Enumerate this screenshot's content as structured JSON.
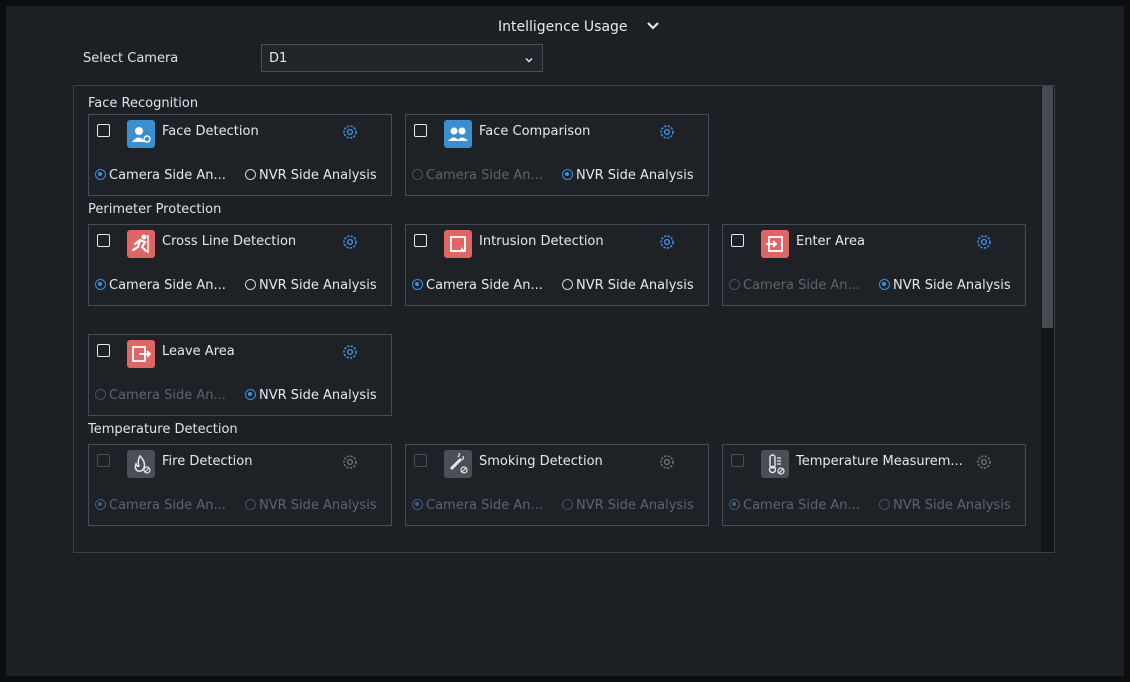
{
  "header": {
    "title": "Intelligence Usage"
  },
  "camera_select": {
    "label": "Select Camera",
    "value": "D1"
  },
  "sections": [
    {
      "title": "Face Recognition"
    },
    {
      "title": "Perimeter Protection"
    },
    {
      "title": "Temperature Detection"
    }
  ],
  "cards": [
    {
      "name": "Face Detection",
      "opt1": "Camera Side An...",
      "opt2": "NVR Side Analysis",
      "selected": "camera",
      "icon": "face-detection-icon"
    },
    {
      "name": "Face Comparison",
      "opt1": "Camera Side An...",
      "opt2": "NVR Side Analysis",
      "selected": "nvr",
      "icon": "face-comparison-icon"
    },
    {
      "name": "Cross Line Detection",
      "opt1": "Camera Side An...",
      "opt2": "NVR Side Analysis",
      "selected": "camera",
      "icon": "cross-line-icon"
    },
    {
      "name": "Intrusion Detection",
      "opt1": "Camera Side An...",
      "opt2": "NVR Side Analysis",
      "selected": "camera",
      "icon": "intrusion-icon"
    },
    {
      "name": "Enter Area",
      "opt1": "Camera Side An...",
      "opt2": "NVR Side Analysis",
      "selected": "nvr",
      "icon": "enter-area-icon"
    },
    {
      "name": "Leave Area",
      "opt1": "Camera Side An...",
      "opt2": "NVR Side Analysis",
      "selected": "nvr",
      "icon": "leave-area-icon"
    },
    {
      "name": "Fire Detection",
      "opt1": "Camera Side An...",
      "opt2": "NVR Side Analysis",
      "selected": "camera",
      "icon": "fire-detection-icon"
    },
    {
      "name": "Smoking Detection",
      "opt1": "Camera Side An...",
      "opt2": "NVR Side Analysis",
      "selected": "camera",
      "icon": "smoking-detection-icon"
    },
    {
      "name": "Temperature Measurem...",
      "opt1": "Camera Side An...",
      "opt2": "NVR Side Analysis",
      "selected": "camera",
      "icon": "temperature-icon"
    }
  ],
  "colors": {
    "accent": "#3d8fe3",
    "face_icon_bg": "#3a8fd0",
    "perimeter_icon_bg": "#e06666",
    "disabled_icon_bg": "#4a4f57"
  }
}
